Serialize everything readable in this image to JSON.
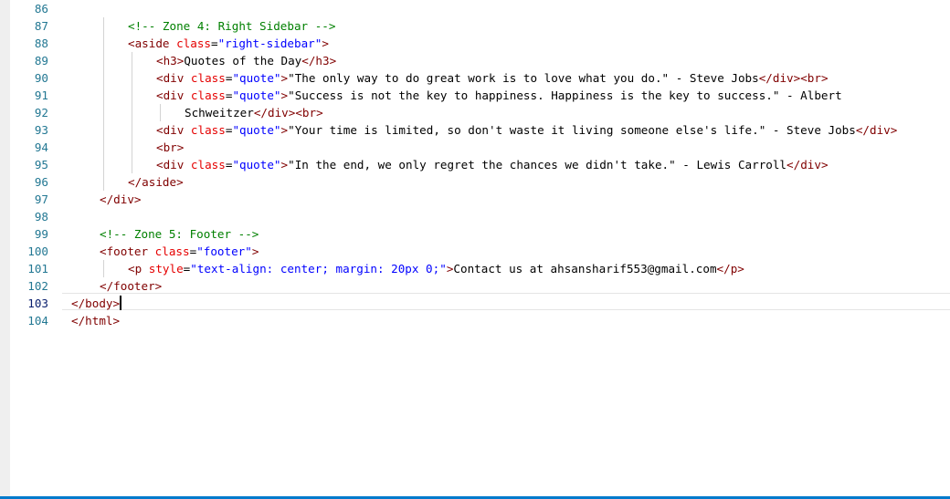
{
  "editor": {
    "current_line": "103",
    "lines": [
      {
        "n": "86",
        "segs": []
      },
      {
        "n": "87",
        "segs": [
          {
            "t": "<!-- Zone 4: Right Sidebar -->",
            "c": "comment"
          }
        ]
      },
      {
        "n": "88",
        "segs": [
          {
            "t": "<aside ",
            "c": "tag"
          },
          {
            "t": "class",
            "c": "attr"
          },
          {
            "t": "=",
            "c": "txt"
          },
          {
            "t": "\"right-sidebar\"",
            "c": "str"
          },
          {
            "t": ">",
            "c": "tag"
          }
        ]
      },
      {
        "n": "89",
        "segs": [
          {
            "t": "<h3>",
            "c": "tag"
          },
          {
            "t": "Quotes of the Day",
            "c": "txt"
          },
          {
            "t": "</h3>",
            "c": "tag"
          }
        ]
      },
      {
        "n": "90",
        "segs": [
          {
            "t": "<div ",
            "c": "tag"
          },
          {
            "t": "class",
            "c": "attr"
          },
          {
            "t": "=",
            "c": "txt"
          },
          {
            "t": "\"quote\"",
            "c": "str"
          },
          {
            "t": ">",
            "c": "tag"
          },
          {
            "t": "\"The only way to do great work is to love what you do.\" - Steve Jobs",
            "c": "txt"
          },
          {
            "t": "</div><br>",
            "c": "tag"
          }
        ]
      },
      {
        "n": "91",
        "segs": [
          {
            "t": "<div ",
            "c": "tag"
          },
          {
            "t": "class",
            "c": "attr"
          },
          {
            "t": "=",
            "c": "txt"
          },
          {
            "t": "\"quote\"",
            "c": "str"
          },
          {
            "t": ">",
            "c": "tag"
          },
          {
            "t": "\"Success is not the key to happiness. Happiness is the key to success.\" - Albert",
            "c": "txt"
          }
        ]
      },
      {
        "n": "92",
        "segs": [
          {
            "t": "Schweitzer",
            "c": "txt"
          },
          {
            "t": "</div><br>",
            "c": "tag"
          }
        ]
      },
      {
        "n": "93",
        "segs": [
          {
            "t": "<div ",
            "c": "tag"
          },
          {
            "t": "class",
            "c": "attr"
          },
          {
            "t": "=",
            "c": "txt"
          },
          {
            "t": "\"quote\"",
            "c": "str"
          },
          {
            "t": ">",
            "c": "tag"
          },
          {
            "t": "\"Your time is limited, so don't waste it living someone else's life.\" - Steve Jobs",
            "c": "txt"
          },
          {
            "t": "</div>",
            "c": "tag"
          }
        ]
      },
      {
        "n": "94",
        "segs": [
          {
            "t": "<br>",
            "c": "tag"
          }
        ]
      },
      {
        "n": "95",
        "segs": [
          {
            "t": "<div ",
            "c": "tag"
          },
          {
            "t": "class",
            "c": "attr"
          },
          {
            "t": "=",
            "c": "txt"
          },
          {
            "t": "\"quote\"",
            "c": "str"
          },
          {
            "t": ">",
            "c": "tag"
          },
          {
            "t": "\"In the end, we only regret the chances we didn't take.\" - Lewis Carroll",
            "c": "txt"
          },
          {
            "t": "</div>",
            "c": "tag"
          }
        ]
      },
      {
        "n": "96",
        "segs": [
          {
            "t": "</aside>",
            "c": "tag"
          }
        ]
      },
      {
        "n": "97",
        "segs": [
          {
            "t": "</div>",
            "c": "tag"
          }
        ]
      },
      {
        "n": "98",
        "segs": []
      },
      {
        "n": "99",
        "segs": [
          {
            "t": "<!-- Zone 5: Footer -->",
            "c": "comment"
          }
        ]
      },
      {
        "n": "100",
        "segs": [
          {
            "t": "<footer ",
            "c": "tag"
          },
          {
            "t": "class",
            "c": "attr"
          },
          {
            "t": "=",
            "c": "txt"
          },
          {
            "t": "\"footer\"",
            "c": "str"
          },
          {
            "t": ">",
            "c": "tag"
          }
        ]
      },
      {
        "n": "101",
        "segs": [
          {
            "t": "<p ",
            "c": "tag"
          },
          {
            "t": "style",
            "c": "attr"
          },
          {
            "t": "=",
            "c": "txt"
          },
          {
            "t": "\"text-align: center; margin: 20px 0;\"",
            "c": "str"
          },
          {
            "t": ">",
            "c": "tag"
          },
          {
            "t": "Contact us at ahsansharif553@gmail.com",
            "c": "txt"
          },
          {
            "t": "</p>",
            "c": "tag"
          }
        ]
      },
      {
        "n": "102",
        "segs": [
          {
            "t": "</footer>",
            "c": "tag"
          }
        ]
      },
      {
        "n": "103",
        "segs": [
          {
            "t": "</body>",
            "c": "tag"
          }
        ]
      },
      {
        "n": "104",
        "segs": [
          {
            "t": "</html>",
            "c": "tag"
          }
        ]
      }
    ]
  }
}
